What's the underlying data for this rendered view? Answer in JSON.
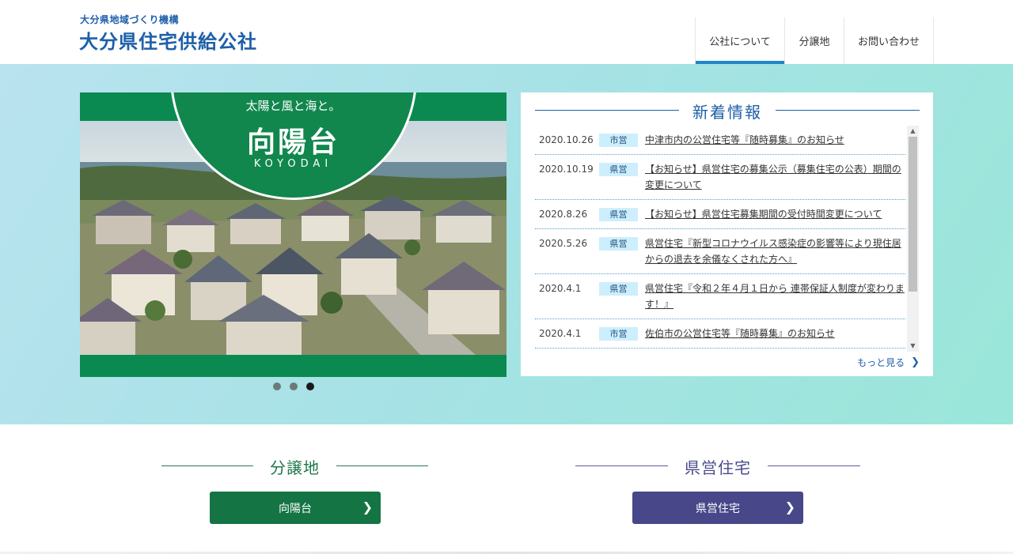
{
  "header": {
    "org_sub": "大分県地域づくり機構",
    "org_name": "大分県住宅供給公社",
    "nav": [
      {
        "label": "公社について",
        "active": true
      },
      {
        "label": "分譲地",
        "active": false
      },
      {
        "label": "お問い合わせ",
        "active": false
      }
    ]
  },
  "hero": {
    "slide": {
      "tagline": "太陽と風と海と。",
      "title": "向陽台",
      "roman": "KOYODAI"
    },
    "slide_count": 3,
    "active_slide": 3
  },
  "news": {
    "title": "新着情報",
    "items": [
      {
        "date": "2020.10.26",
        "category": "市営",
        "text": "中津市内の公営住宅等『随時募集』のお知らせ"
      },
      {
        "date": "2020.10.19",
        "category": "県営",
        "text": "【お知らせ】県営住宅の募集公示（募集住宅の公表）期間の変更について"
      },
      {
        "date": "2020.8.26",
        "category": "県営",
        "text": "【お知らせ】県営住宅募集期間の受付時間変更について"
      },
      {
        "date": "2020.5.26",
        "category": "県営",
        "text": "県営住宅『新型コロナウイルス感染症の影響等により現住居からの退去を余儀なくされた方へ』"
      },
      {
        "date": "2020.4.1",
        "category": "県営",
        "text": "県営住宅『令和２年４月１日から 連帯保証人制度が変わります！』"
      },
      {
        "date": "2020.4.1",
        "category": "市営",
        "text": "佐伯市の公営住宅等『随時募集』のお知らせ"
      }
    ],
    "more_label": "もっと見る"
  },
  "sections": [
    {
      "title": "分譲地",
      "button": "向陽台"
    },
    {
      "title": "県営住宅",
      "button": "県営住宅"
    }
  ],
  "colors": {
    "brand_blue": "#1d5fa8",
    "green": "#147443",
    "purple": "#47478a",
    "hero_bg": "#a7e2e6"
  }
}
